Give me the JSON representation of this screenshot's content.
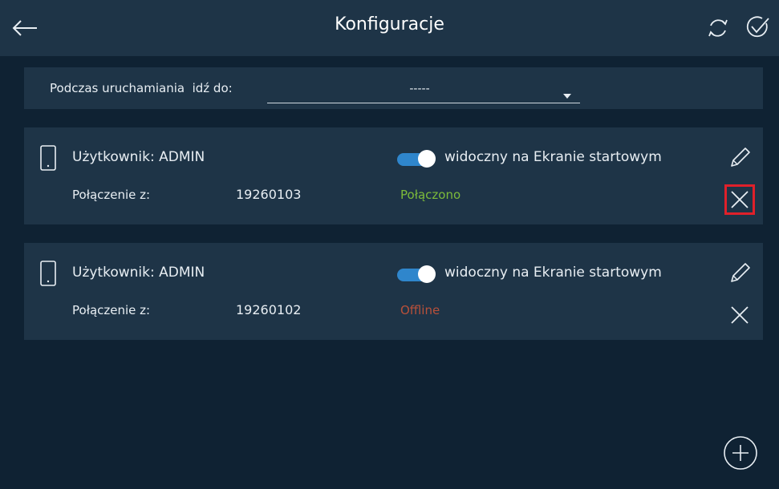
{
  "header": {
    "title": "Konfiguracje",
    "back_icon": "arrow-left-icon",
    "refresh_icon": "refresh-icon",
    "confirm_icon": "check-circle-icon"
  },
  "startup": {
    "label": "Podczas uruchamiania  idź do:",
    "selected_value": "-----",
    "caret_icon": "caret-down-icon"
  },
  "devices": [
    {
      "user_label": "Użytkownik: ADMIN",
      "visible_label": "widoczny na Ekranie startowym",
      "visible_on": true,
      "connection_label": "Połączenie z:",
      "connection_id": "19260103",
      "status": "Połączono",
      "status_color": "#7cbb3a",
      "delete_highlighted": true
    },
    {
      "user_label": "Użytkownik: ADMIN",
      "visible_label": "widoczny na Ekranie startowym",
      "visible_on": true,
      "connection_label": "Połączenie z:",
      "connection_id": "19260102",
      "status": "Offline",
      "status_color": "#b8503a",
      "delete_highlighted": false
    }
  ],
  "colors": {
    "background": "#0f2233",
    "panel": "#1e3447",
    "accent": "#2f86cc",
    "highlight": "#e0202a"
  },
  "icons": {
    "device": "phone-icon",
    "edit": "pencil-icon",
    "delete": "close-icon",
    "add": "plus-circle-icon"
  }
}
